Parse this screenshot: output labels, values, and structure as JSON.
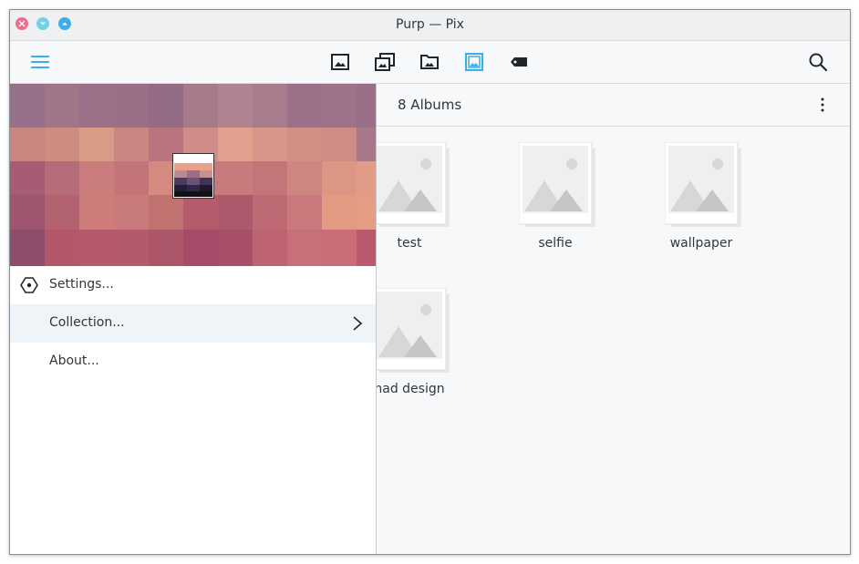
{
  "window": {
    "title": "Purp — Pix"
  },
  "toolbar": {
    "menu_icon": "hamburger-menu-icon",
    "views": [
      {
        "name": "gallery",
        "icon": "image-icon",
        "active": false
      },
      {
        "name": "albums",
        "icon": "albums-icon",
        "active": false
      },
      {
        "name": "folders",
        "icon": "folder-image-icon",
        "active": false
      },
      {
        "name": "viewer",
        "icon": "picture-frame-icon",
        "active": true
      },
      {
        "name": "tags",
        "icon": "tag-icon",
        "active": false
      }
    ],
    "search_icon": "search-icon"
  },
  "content": {
    "header_title": "8 Albums",
    "albums": [
      {
        "label": "test"
      },
      {
        "label": "selfie"
      },
      {
        "label": "wallpaper"
      },
      {
        "label": "nad design"
      }
    ]
  },
  "drawer": {
    "menu": [
      {
        "label": "Settings...",
        "icon": "settings-icon"
      },
      {
        "label": "Collection...",
        "icon": "chevron-right-icon"
      },
      {
        "label": "About..."
      }
    ]
  },
  "colors": {
    "accent": "#3daee9",
    "text": "#31363b",
    "close": "#ed6d8e",
    "minimize": "#6ed3e8",
    "maximize": "#3daee9"
  }
}
